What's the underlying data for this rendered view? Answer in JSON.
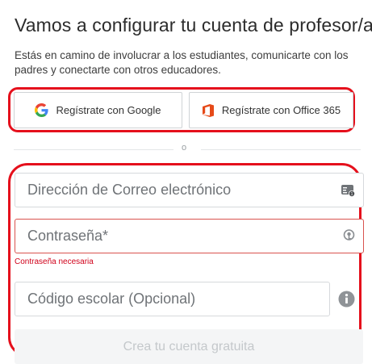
{
  "header": {
    "title": "Vamos a configurar tu cuenta de profesor/a",
    "subtitle": "Estás en camino de involucrar a los estudiantes, comunicarte con los padres y conectarte con otros educadores."
  },
  "sso": {
    "google_label": "Regístrate con Google",
    "office_label": "Regístrate con Office 365"
  },
  "divider": {
    "text": "o"
  },
  "form": {
    "email_placeholder": "Dirección de Correo electrónico",
    "email_value": "",
    "password_placeholder": "Contraseña*",
    "password_value": "",
    "password_error": "Contraseña necesaria",
    "school_placeholder": "Código escolar (Opcional)",
    "school_value": "",
    "submit_label": "Crea tu cuenta gratuita"
  },
  "icons": {
    "google": "google-logo-icon",
    "office": "office-365-logo-icon",
    "email_field": "contact-card-icon",
    "password_field": "password-key-icon",
    "school_field": "info-icon"
  },
  "colors": {
    "highlight": "#e5101c",
    "error": "#d0021b",
    "office_brand": "#e64a19",
    "cta_disabled_bg": "#f4f5f6",
    "cta_disabled_text": "#c4c8cb"
  }
}
